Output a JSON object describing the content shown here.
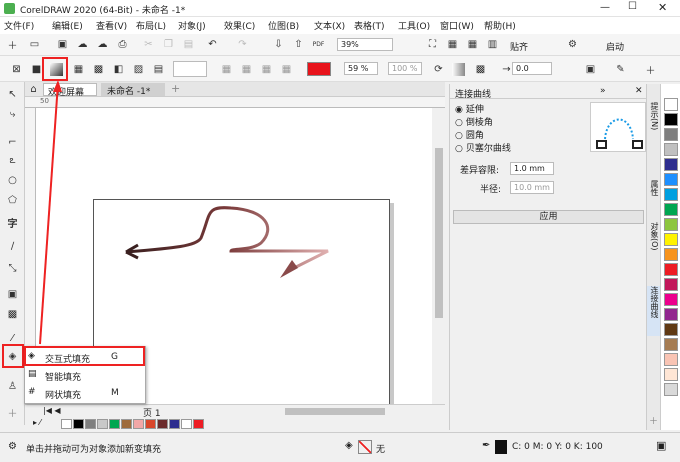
{
  "window": {
    "title": "CorelDRAW 2020 (64-Bit) - 未命名 -1*"
  },
  "menu": [
    "文件(F)",
    "编辑(E)",
    "查看(V)",
    "布局(L)",
    "对象(J)",
    "效果(C)",
    "位图(B)",
    "文本(X)",
    "表格(T)",
    "工具(O)",
    "窗口(W)",
    "帮助(H)"
  ],
  "toolbar": {
    "zoom": "39%",
    "snap_label": "贴齐",
    "launch_label": "启动"
  },
  "propbar": {
    "opacity": "59 %",
    "scale": "100 %",
    "offset": "0.0",
    "fill_color": "#e8131b"
  },
  "tabs": [
    "欢迎屏幕",
    "未命名 -1*"
  ],
  "docker": {
    "title": "连接曲线",
    "options": [
      "延伸",
      "倒棱角",
      "圆角",
      "贝塞尔曲线"
    ],
    "tolerance_label": "差异容限:",
    "tolerance_value": "1.0 mm",
    "radius_label": "半径:",
    "radius_value": "10.0 mm",
    "apply_label": "应用"
  },
  "side_tabs": [
    "提示(N)",
    "属性",
    "对象(O)",
    "连接曲线"
  ],
  "ruler_mark": "50",
  "context_menu": [
    {
      "label": "交互式填充",
      "key": "G"
    },
    {
      "label": "智能填充",
      "key": ""
    },
    {
      "label": "网状填充",
      "key": "M"
    }
  ],
  "page_tab": "页 1",
  "status": {
    "hint": "单击并拖动可为对象添加新变填充",
    "fill_none": "无",
    "cmyk": "C: 0 M: 0 Y: 0 K: 100"
  },
  "palette_colors": [
    "#ffffff",
    "#000000",
    "#7f7f7f",
    "#c0c0c0",
    "#2e2e8f",
    "#1e90ff",
    "#00a0e0",
    "#00a651",
    "#8dc63f",
    "#fff200",
    "#f7941d",
    "#ed1c24",
    "#c2185b",
    "#ec008c",
    "#92278f",
    "#603913",
    "#a67c52",
    "#f9c4b4",
    "#ffe6d5",
    "#d9d9d9"
  ],
  "palette_bottom": [
    "#ffffff",
    "#000000",
    "#7f7f7f",
    "#c8c8c8",
    "#00a651",
    "#9e6b3c",
    "#f2a7a7",
    "#d9472b",
    "#6b2b2b",
    "#2e2e8f",
    "#ffffff",
    "#ed1c24"
  ]
}
